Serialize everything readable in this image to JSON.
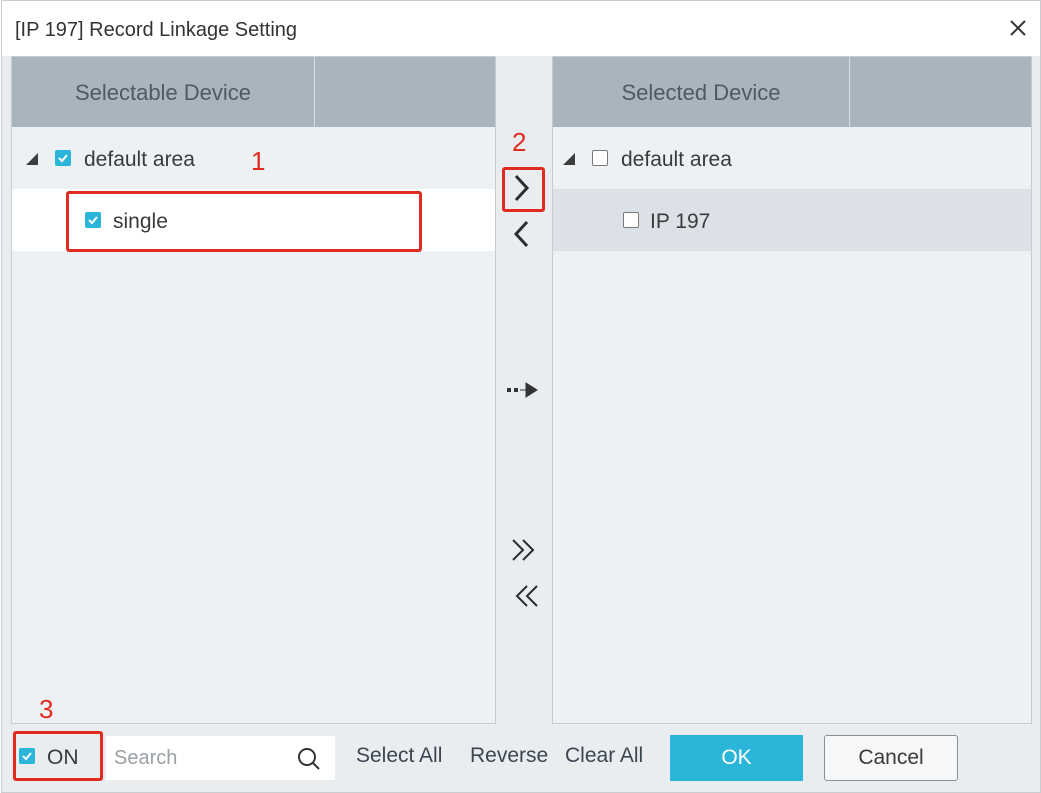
{
  "window": {
    "title": "[IP 197] Record Linkage Setting"
  },
  "left_panel": {
    "header": "Selectable Device",
    "items": [
      {
        "label": "default area",
        "checked": true
      },
      {
        "label": "single",
        "checked": true
      }
    ]
  },
  "right_panel": {
    "header": "Selected Device",
    "items": [
      {
        "label": "default area",
        "checked": false
      },
      {
        "label": "IP 197",
        "checked": false
      }
    ]
  },
  "transfer_buttons": [
    "add-selected",
    "remove-selected",
    "add-linked",
    "add-all",
    "remove-all"
  ],
  "annotations": [
    "1",
    "2",
    "3"
  ],
  "bottom": {
    "on_label": "ON",
    "on_checked": true,
    "search_placeholder": "Search",
    "select_all": "Select All",
    "reverse": "Reverse",
    "clear_all": "Clear All",
    "ok": "OK",
    "cancel": "Cancel"
  },
  "colors": {
    "accent": "#2bb6d9",
    "header_bg": "#a8b5bf",
    "annotation": "#e22b20"
  }
}
